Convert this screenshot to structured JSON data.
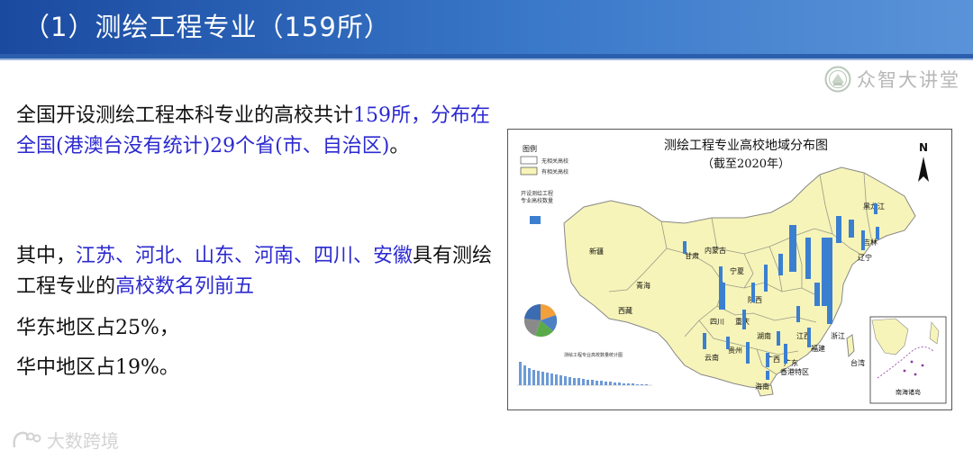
{
  "header": {
    "title": "（1）测绘工程专业（159所）"
  },
  "brand": {
    "name": "众智大讲堂",
    "seal_icon": "university-seal-icon"
  },
  "content": {
    "p1": [
      "全国开设测绘工程本科专业的高校共计",
      "159",
      "所，分布在全国(港澳台没有统计)",
      "29个省(市、自治区)",
      "。"
    ],
    "p2": [
      "其中，",
      "江苏、河北、山东、河南、四川、安徽",
      "具有测绘工程专业的",
      "高校数名列前五"
    ],
    "p3": "华东地区占25%，",
    "p4": "华中地区占19%。"
  },
  "map": {
    "title": "测绘工程专业高校地域分布图",
    "subtitle": "（截至2020年）",
    "north": "N",
    "legend": {
      "title": "图例",
      "no_school": "无相关高校",
      "has_school": "有相关高校",
      "bar_label_1": "开设测绘工程",
      "bar_label_2": "专业高校数量"
    },
    "provinces": [
      "新疆",
      "西藏",
      "青海",
      "甘肃",
      "内蒙古",
      "黑龙江",
      "吉林",
      "辽宁",
      "宁夏",
      "陕西",
      "四川",
      "重庆",
      "云南",
      "贵州",
      "湖南",
      "广西",
      "广东",
      "江西",
      "福建",
      "浙江",
      "台湾",
      "海南",
      "香港特区"
    ],
    "inset_label": "南海诸岛",
    "small_chart_title": "测绘工程专业高校数量统计图",
    "colors": {
      "land": "#f6f4b8",
      "border": "#888888",
      "bar": "#3b7fd0"
    }
  },
  "watermark": "大数跨境"
}
